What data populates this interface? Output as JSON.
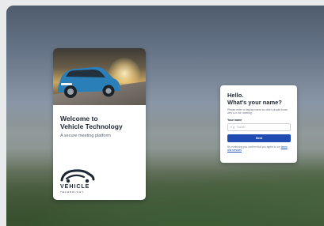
{
  "welcome": {
    "title_line1": "Welcome to",
    "title_line2": "Vehicle Technology",
    "subtitle": "A secure meeting platform",
    "logo_word": "VEHICLE",
    "logo_sub": "TECHNOLOGY"
  },
  "form": {
    "heading_line1": "Hello.",
    "heading_line2": "What's your name?",
    "description": "Please enter a display name so other people know who's in the meeting.",
    "field_label": "Your name",
    "placeholder": "e.g. \"Sarah\"",
    "value": "",
    "next_label": "Next",
    "terms_prefix": "By continuing you confirm that you agree to our",
    "terms_link": "terms and services"
  },
  "colors": {
    "accent": "#1f4bb3",
    "text_dark": "#1d2633",
    "car": "#2a7fb8"
  },
  "icons": [
    "vehicle-logo-icon"
  ]
}
